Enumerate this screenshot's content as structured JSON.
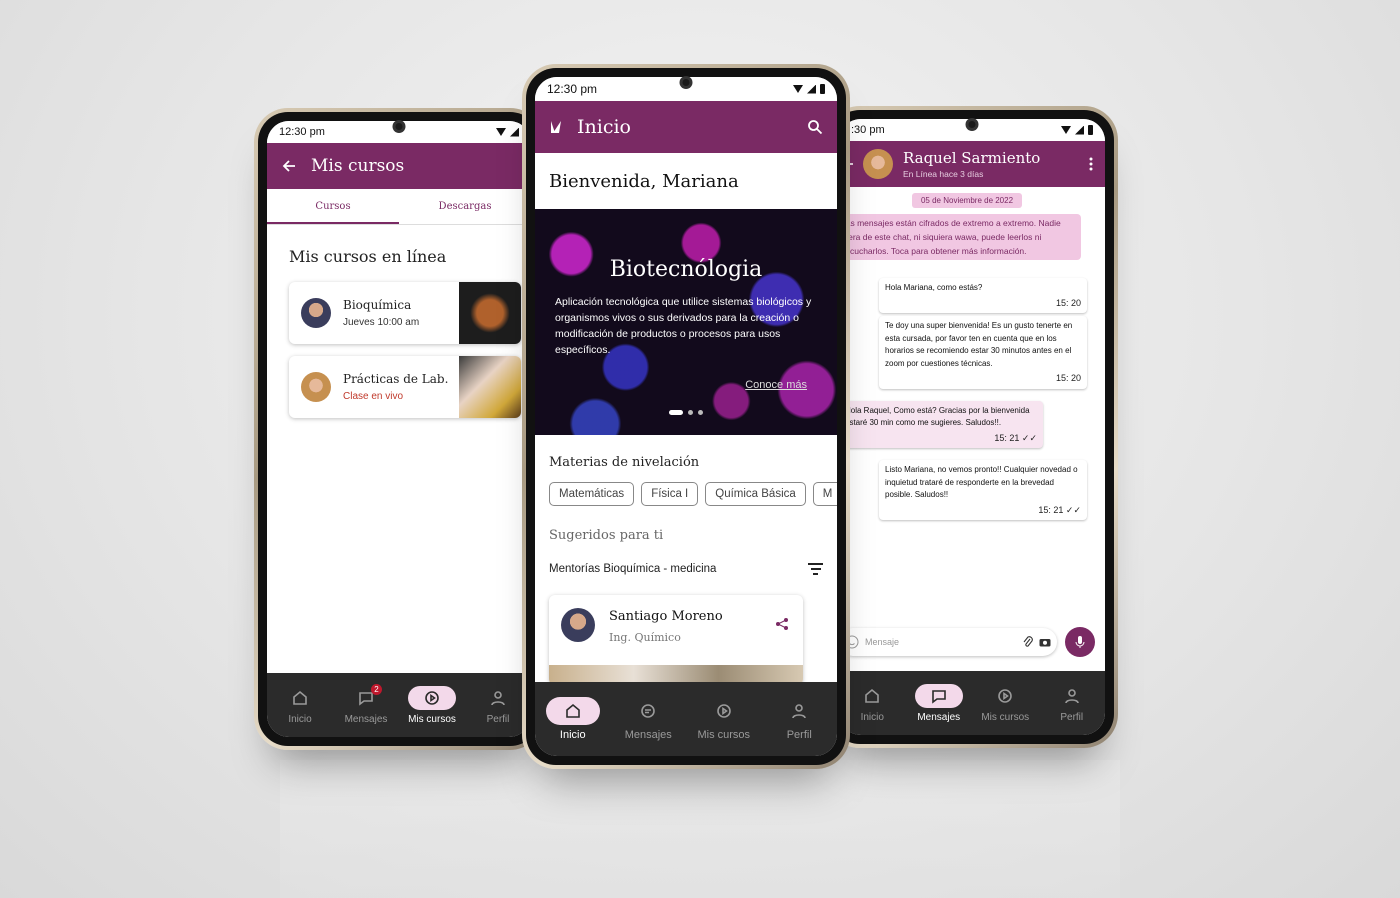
{
  "colors": {
    "brand": "#7a2a64",
    "nav_bg": "#2b2b2b",
    "pill": "#f3d9ea",
    "alert": "#c0392b"
  },
  "left": {
    "status_time": "12:30 pm",
    "title": "Mis cursos",
    "tabs": [
      "Cursos",
      "Descargas"
    ],
    "heading": "Mis cursos en línea",
    "courses": [
      {
        "name": "Bioquímica",
        "sub": "Jueves 10:00 am"
      },
      {
        "name": "Prácticas de Lab.",
        "sub": "Clase en vivo"
      }
    ],
    "nav": [
      "Inicio",
      "Mensajes",
      "Mis cursos",
      "Perfil"
    ],
    "badge": "2"
  },
  "center": {
    "status_time": "12:30 pm",
    "title": "Inicio",
    "welcome": "Bienvenida, Mariana",
    "hero": {
      "title": "Biotecnólogia",
      "desc": "Aplicación tecnológica que utilice sistemas biológicos y organismos vivos o sus derivados para la creación o modificación de productos o procesos para usos específicos.",
      "link": "Conoce más"
    },
    "leveling_title": "Materias de nivelación",
    "chips": [
      "Matemáticas",
      "Física I",
      "Química Básica",
      "M"
    ],
    "suggested_title": "Sugeridos para ti",
    "filter_label": "Mentorías Bioquímica - medicina",
    "mentor": {
      "name": "Santiago Moreno",
      "role": "Ing. Químico"
    },
    "nav": [
      "Inicio",
      "Mensajes",
      "Mis cursos",
      "Perfil"
    ]
  },
  "right": {
    "status_time": ":30 pm",
    "name": "Raquel Sarmiento",
    "status": "En Línea hace 3 días",
    "date": "05 de Noviembre de 2022",
    "encryption": "Las mensajes están cifrados de extremo a extremo. Nadie fuera de este chat, ni siquiera wawa, puede leerlos ni escucharlos. Toca para obtener más información.",
    "messages": [
      {
        "text": "Hola Mariana, como estás?",
        "time": "15: 20"
      },
      {
        "text": "Te doy una super bienvenida! Es un gusto tenerte en esta cursada, por favor ten en cuenta que en los horarios se recomiendo estar 30 minutos antes en el zoom por cuestiones técnicas.",
        "time": "15: 20"
      },
      {
        "text": "Hola Raquel, Como está? Gracias por la bienvenida estaré 30 min como me sugieres. Saludos!!.",
        "time": "15: 21 ✓✓"
      },
      {
        "text": "Listo Mariana, no vemos pronto!! Cualquier novedad o inquietud trataré de responderte en la brevedad posible. Saludos!!",
        "time": "15: 21 ✓✓"
      }
    ],
    "composer_placeholder": "Mensaje",
    "nav": [
      "Inicio",
      "Mensajes",
      "Mis cursos",
      "Perfil"
    ]
  }
}
